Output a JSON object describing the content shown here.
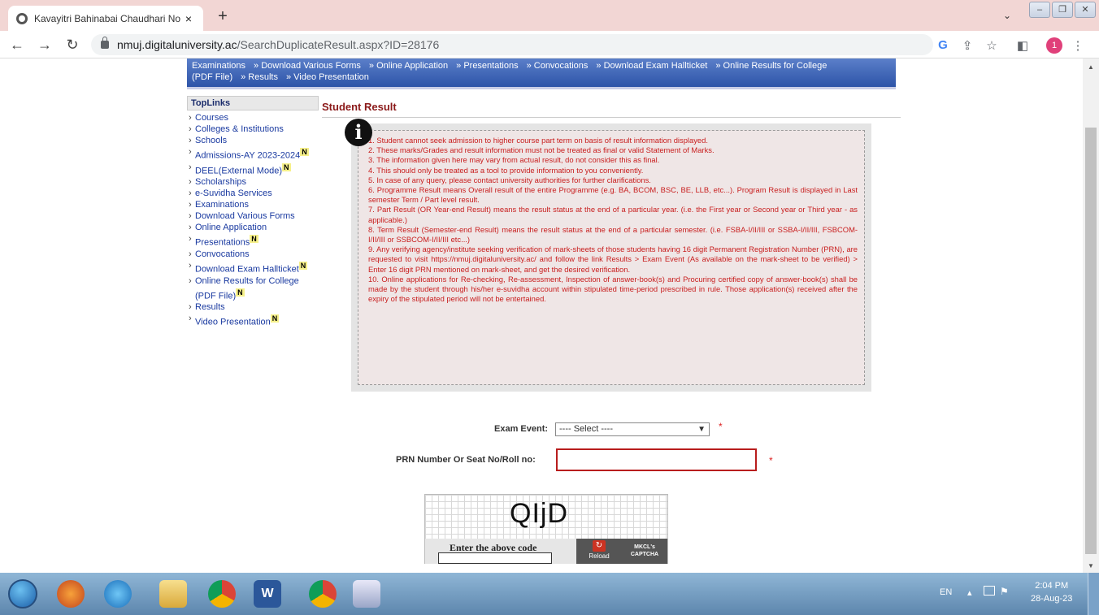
{
  "browser": {
    "tab_title": "Kavayitri Bahinabai Chaudhari No",
    "tab_close": "×",
    "new_tab": "+",
    "url_host": "nmuj.digitaluniversity.ac",
    "url_path": "/SearchDuplicateResult.aspx?ID=28176",
    "profile_initial": "1"
  },
  "menubar": {
    "line1": [
      "Examinations",
      "» Download Various Forms",
      "» Online Application",
      "» Presentations",
      "» Convocations",
      "» Download Exam Hallticket",
      "» Online Results for College"
    ],
    "line2": [
      "(PDF File)",
      "» Results",
      "» Video Presentation"
    ]
  },
  "sidebar": {
    "header": "TopLinks",
    "items": [
      {
        "label": "Courses",
        "new": ""
      },
      {
        "label": "Colleges & Institutions",
        "new": ""
      },
      {
        "label": "Schools",
        "new": ""
      },
      {
        "label": "Admissions-AY 2023-2024",
        "new": "N"
      },
      {
        "label": "DEEL(External Mode)",
        "new": "N"
      },
      {
        "label": "Scholarships",
        "new": ""
      },
      {
        "label": "e-Suvidha Services",
        "new": ""
      },
      {
        "label": "Examinations",
        "new": ""
      },
      {
        "label": "Download Various Forms",
        "new": ""
      },
      {
        "label": "Online Application",
        "new": ""
      },
      {
        "label": "Presentations",
        "new": "N"
      },
      {
        "label": "Convocations",
        "new": ""
      },
      {
        "label": "Download Exam Hallticket",
        "new": "N"
      },
      {
        "label": "Online Results for College (PDF File)",
        "new": "N"
      },
      {
        "label": "Results",
        "new": ""
      },
      {
        "label": "Video Presentation",
        "new": "N"
      }
    ]
  },
  "main": {
    "title": "Student Result",
    "info_icon": "i",
    "notes": [
      "1. Student cannot seek admission to higher course part term on basis of result information displayed.",
      "2. These marks/Grades and result information must not be treated as final or valid Statement of Marks.",
      "3. The information given here may vary from actual result, do not consider this as final.",
      "4. This should only be treated as a tool to provide information to you conveniently.",
      "5. In case of any query, please contact university authorities for further clarifications.",
      "6. Programme Result means Overall result of the entire Programme (e.g. BA, BCOM, BSC, BE, LLB, etc...). Program Result is displayed in Last semester Term / Part level result.",
      "7. Part Result (OR Year-end Result) means the result status at the end of a particular year. (i.e. the First year or Second year or Third year - as applicable.)",
      "8. Term Result (Semester-end Result) means the result status at the end of a particular semester. (i.e. FSBA-I/II/III or SSBA-I/II/III, FSBCOM-I/II/III or SSBCOM-I/II/III etc...)",
      "9. Any verifying agency/institute seeking verification of mark-sheets of those students having 16 digit Permanent Registration Number (PRN), are requested to visit https://nmuj.digitaluniversity.ac/ and follow the link Results > Exam Event (As available on the mark-sheet to be verified) > Enter 16 digit PRN mentioned on mark-sheet, and get the desired verification.",
      "10. Online applications for Re-checking, Re-assessment, Inspection of answer-book(s) and Procuring certified copy of answer-book(s) shall be made by the student through his/her e-suvidha account within stipulated time-period prescribed in rule. Those application(s) received after the expiry of the stipulated period will not be entertained."
    ],
    "exam_event_label": "Exam Event:",
    "exam_event_value": "---- Select ----",
    "prn_label": "PRN Number Or Seat No/Roll no:",
    "required_mark": "*",
    "captcha": {
      "code": "QIjD",
      "enter_label": "Enter the above code",
      "reload_label": "Reload",
      "brand_line1": "MKCL's",
      "brand_line2": "CAPTCHA"
    }
  },
  "taskbar": {
    "lang": "EN",
    "time": "2:04 PM",
    "date": "28-Aug-23"
  }
}
